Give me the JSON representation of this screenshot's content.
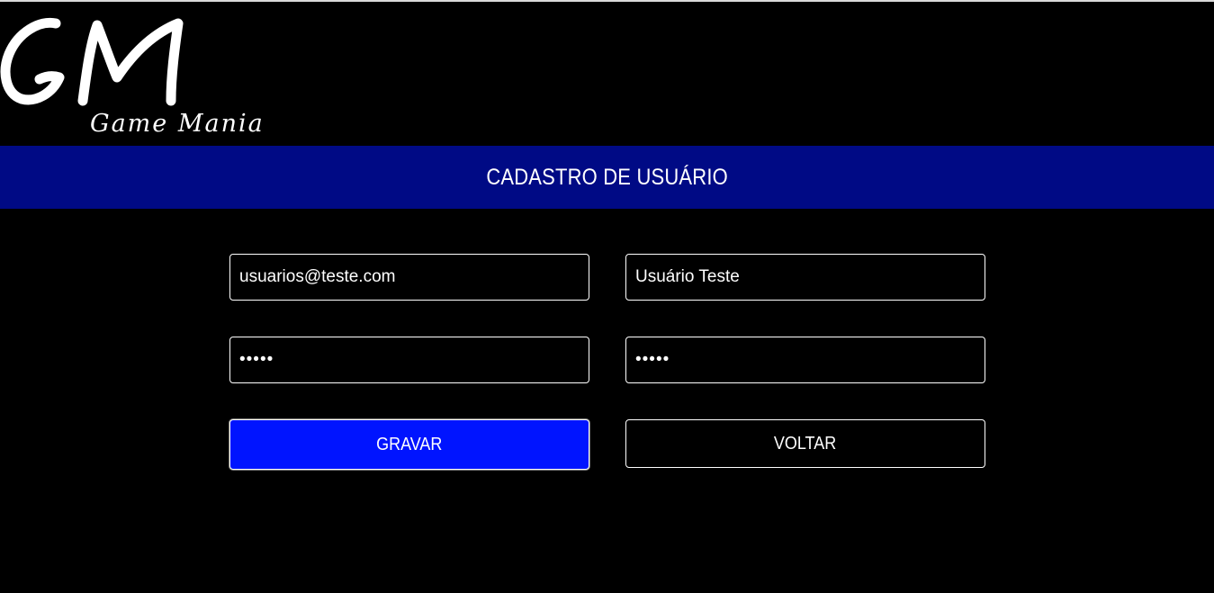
{
  "brand": {
    "monogram": "GM",
    "name": "Game Mania"
  },
  "header": {
    "title": "CADASTRO DE USUÁRIO"
  },
  "form": {
    "email": {
      "value": "usuarios@teste.com"
    },
    "name": {
      "value": "Usuário Teste"
    },
    "password": {
      "value": "•••••"
    },
    "confirm_password": {
      "value": "•••••"
    },
    "save_label": "GRAVAR",
    "back_label": "VOLTAR"
  },
  "colors": {
    "background": "#000000",
    "title_bar": "#000a85",
    "primary_button": "#0014ff",
    "text": "#ffffff",
    "field_border": "#ffffff"
  }
}
